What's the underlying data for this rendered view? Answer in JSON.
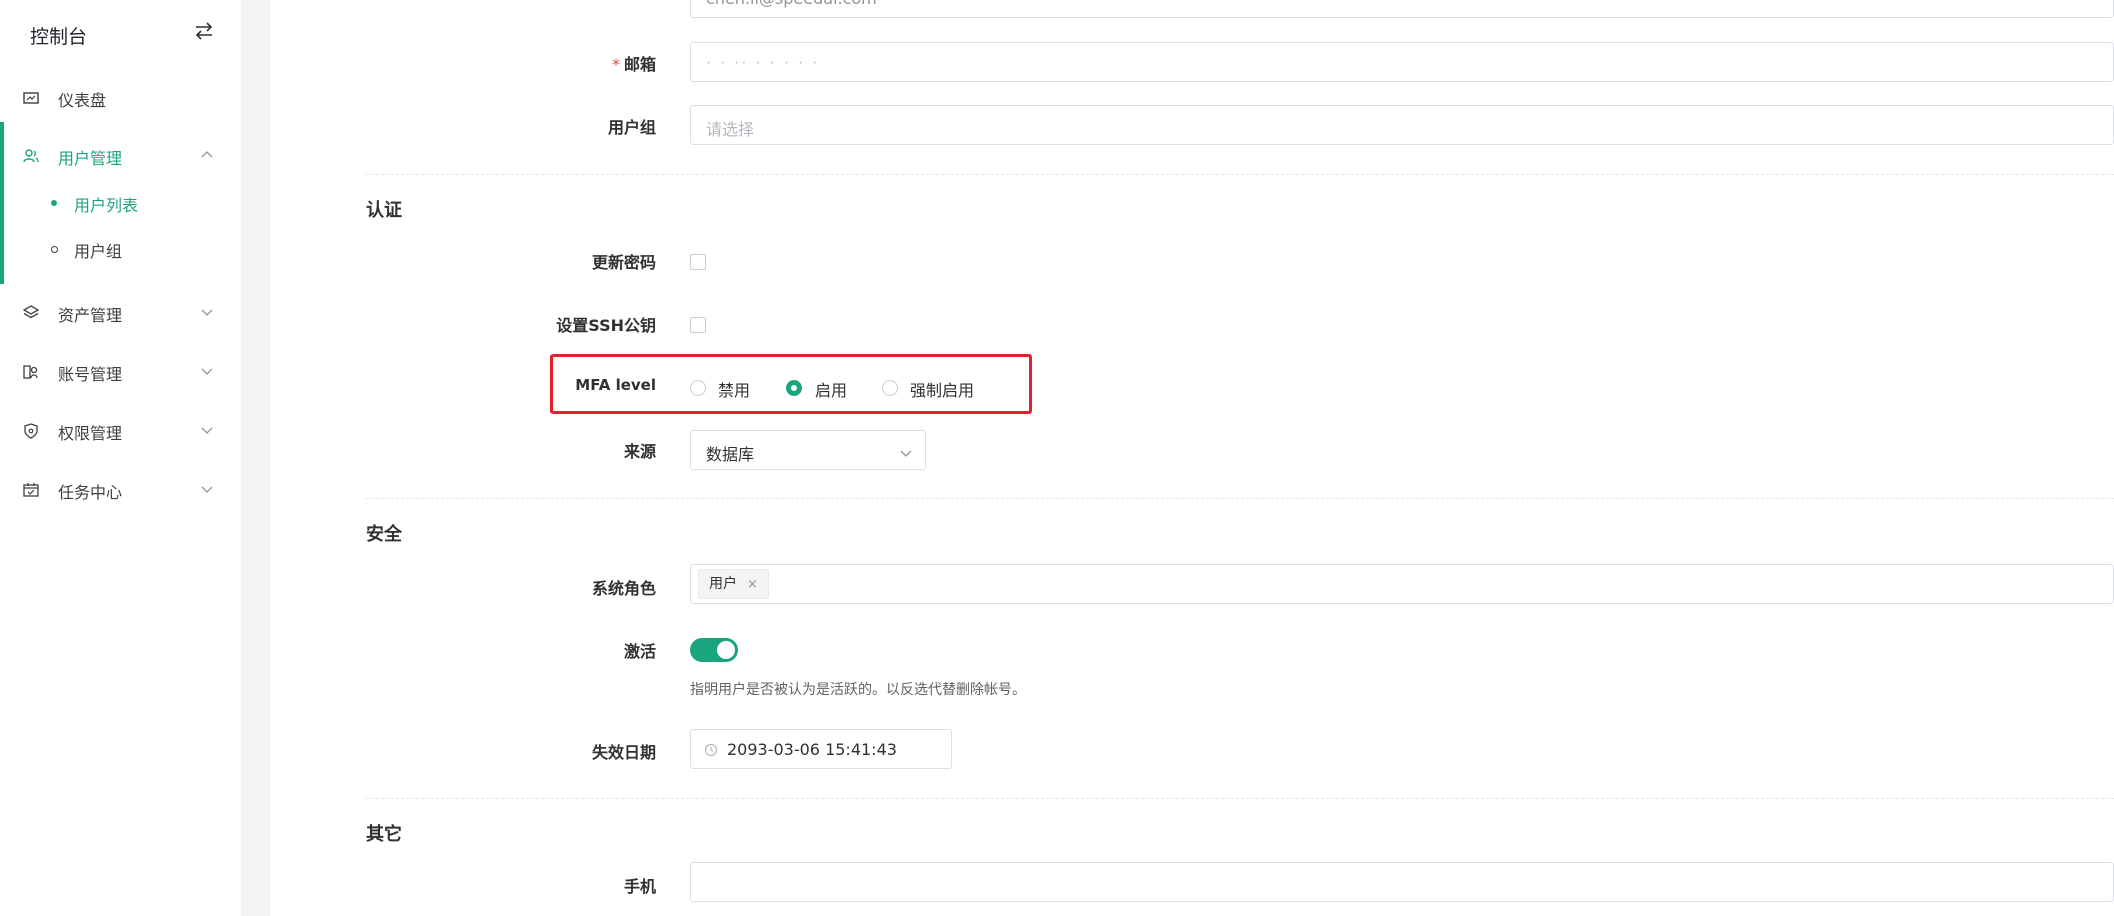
{
  "sidebar": {
    "title": "控制台",
    "toggle_icon": "swap-icon",
    "menu": [
      {
        "label": "仪表盘",
        "icon": "dashboard-icon"
      },
      {
        "label": "用户管理",
        "icon": "users-icon",
        "expanded": true
      },
      {
        "label": "资产管理",
        "icon": "layers-icon"
      },
      {
        "label": "账号管理",
        "icon": "account-icon"
      },
      {
        "label": "权限管理",
        "icon": "shield-icon"
      },
      {
        "label": "任务中心",
        "icon": "calendar-icon"
      }
    ],
    "submenu": [
      {
        "label": "用户列表",
        "active": true
      },
      {
        "label": "用户组",
        "active": false
      }
    ]
  },
  "form": {
    "username_value": "chen.li@speedai.com",
    "email_label": "邮箱",
    "email_value": "· · ·· ·  · ·  ·  ·",
    "usergroup_label": "用户组",
    "usergroup_placeholder": "请选择",
    "auth_section": "认证",
    "update_password_label": "更新密码",
    "set_ssh_label": "设置SSH公钥",
    "mfa_label": "MFA level",
    "mfa_options": [
      "禁用",
      "启用",
      "强制启用"
    ],
    "mfa_selected": "启用",
    "source_label": "来源",
    "source_value": "数据库",
    "security_section": "安全",
    "system_role_label": "系统角色",
    "system_role_tag": "用户",
    "active_label": "激活",
    "active_on": true,
    "active_hint": "指明用户是否被认为是活跃的。以反选代替删除帐号。",
    "expire_label": "失效日期",
    "expire_value": "2093-03-06 15:41:43",
    "other_section": "其它",
    "phone_label": "手机"
  },
  "colors": {
    "accent": "#1aa57f",
    "highlight": "#e5202b",
    "required": "#e2493c"
  }
}
